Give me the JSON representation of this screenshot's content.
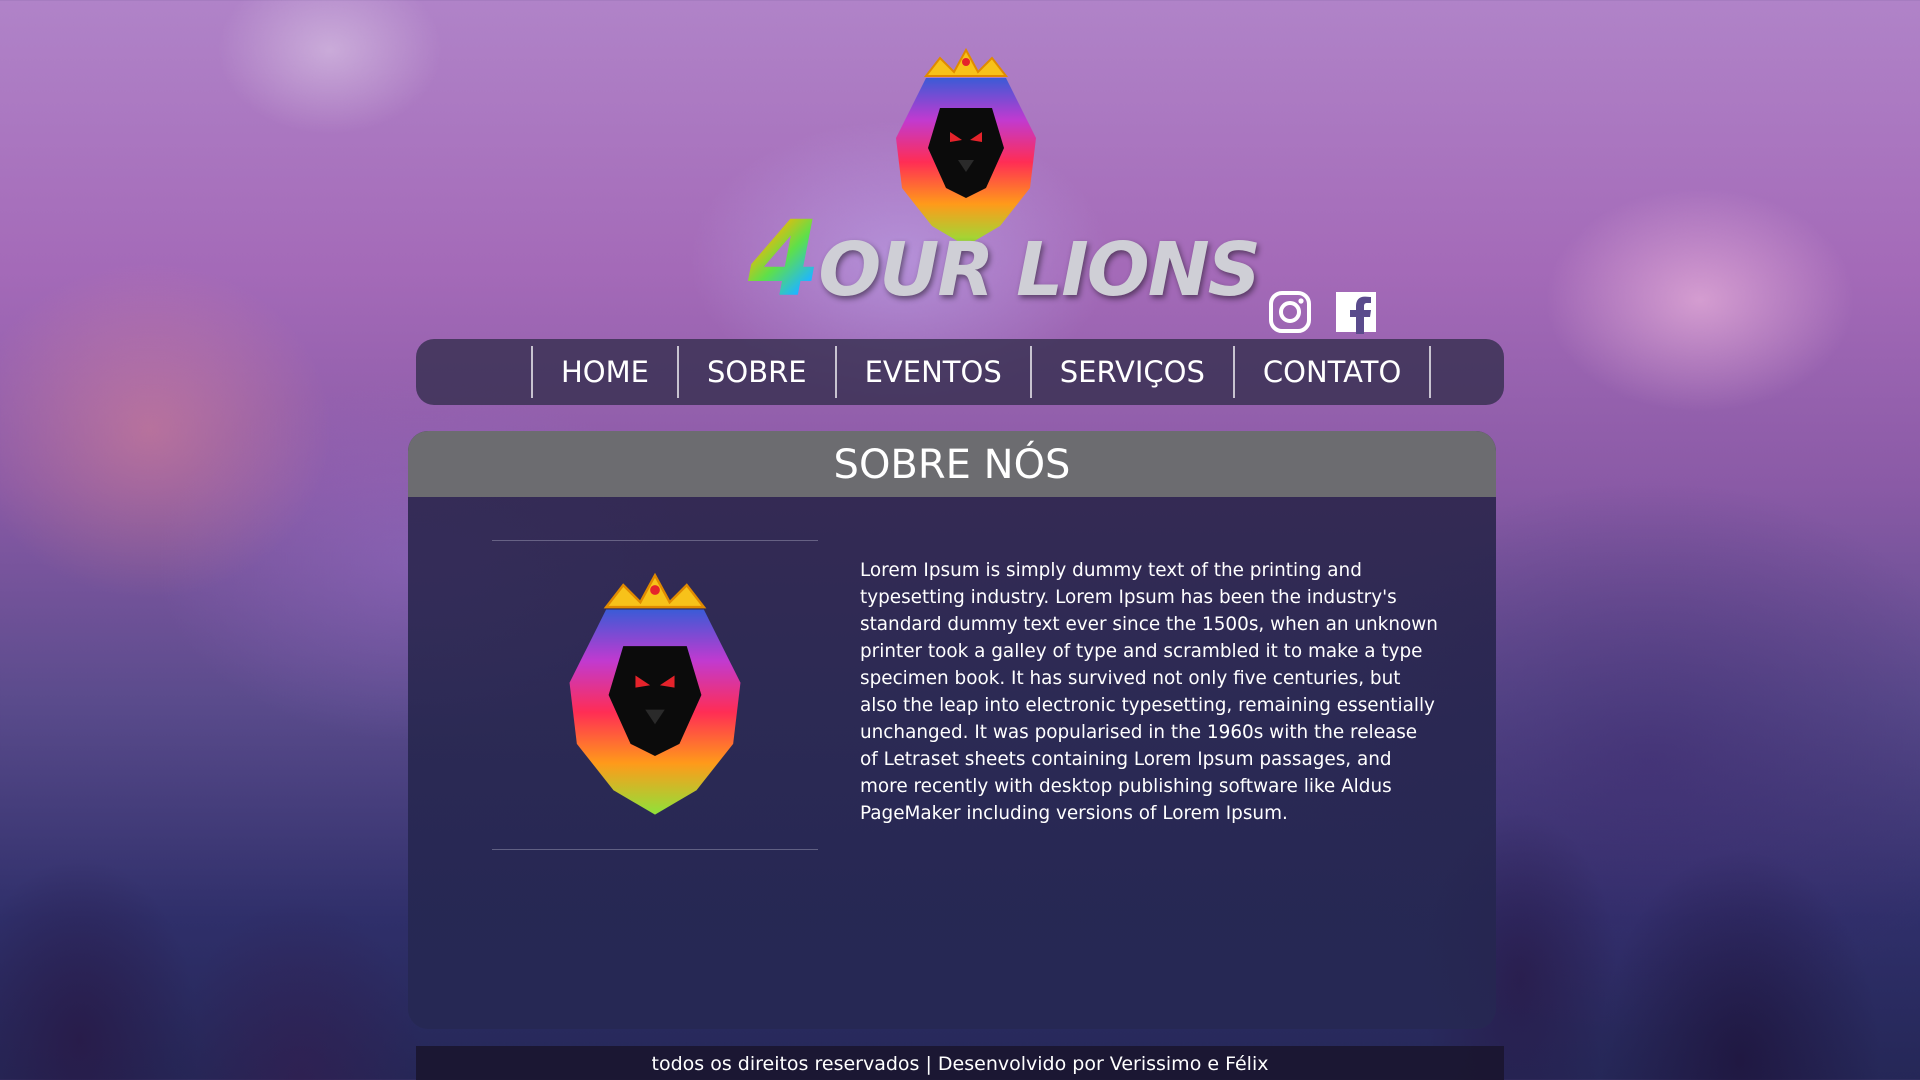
{
  "brand": {
    "logo_text": "OUR LIONS",
    "logo_number": "4"
  },
  "social": {
    "items": [
      {
        "name": "instagram",
        "icon": "instagram-icon"
      },
      {
        "name": "facebook",
        "icon": "facebook-icon"
      }
    ]
  },
  "nav": {
    "items": [
      {
        "label": "HOME"
      },
      {
        "label": "SOBRE"
      },
      {
        "label": "EVENTOS"
      },
      {
        "label": "SERVIÇOS"
      },
      {
        "label": "CONTATO"
      }
    ]
  },
  "about": {
    "title": "SOBRE NÓS",
    "body": "Lorem Ipsum is simply dummy text of the printing and typesetting industry. Lorem Ipsum has been the industry's standard dummy text ever since the 1500s, when an unknown printer took a galley of type and scrambled it to make a type specimen book. It has survived not only five centuries, but also the leap into electronic typesetting, remaining essentially unchanged. It was popularised in the 1960s with the release of Letraset sheets containing Lorem Ipsum passages, and more recently with desktop publishing software like Aldus PageMaker including versions of Lorem Ipsum."
  },
  "footer": {
    "text": "todos os direitos reservados | Desenvolvido por Verissimo e Félix"
  },
  "colors": {
    "nav_bg": "#37304f",
    "card_header_bg": "#6c6c70",
    "footer_bg": "#1a1630"
  }
}
